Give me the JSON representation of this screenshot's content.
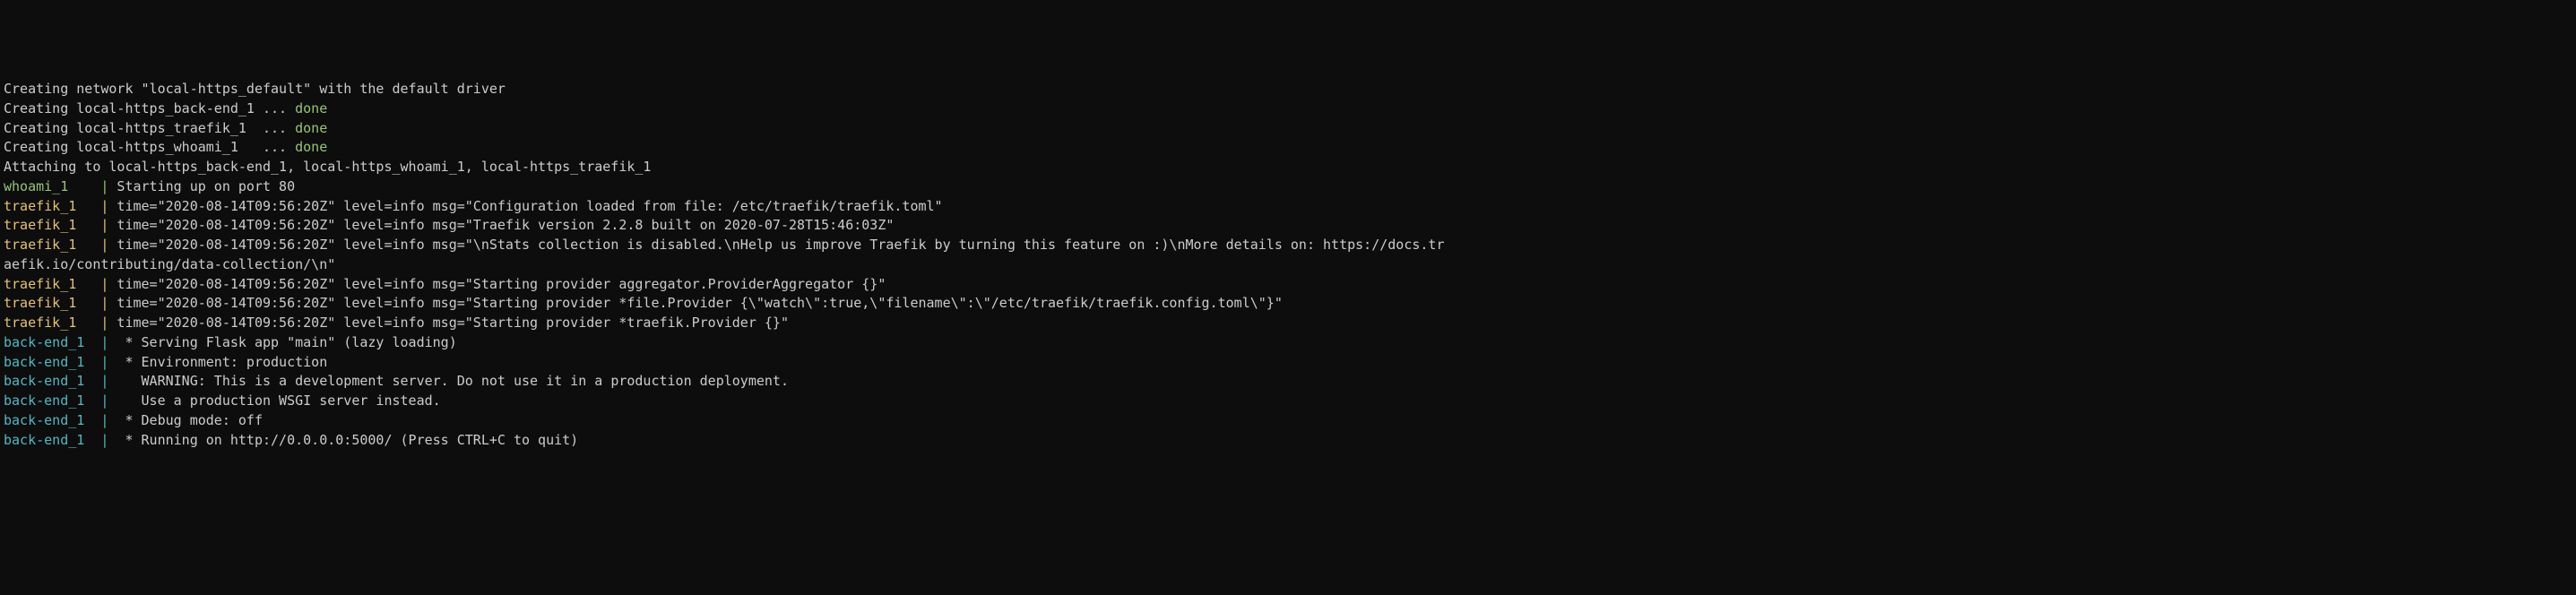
{
  "lines": [
    {
      "segments": [
        {
          "text": "Creating network \"local-https_default\" with the default driver",
          "class": "white"
        }
      ]
    },
    {
      "segments": [
        {
          "text": "Creating local-https_back-end_1 ... ",
          "class": "white"
        },
        {
          "text": "done",
          "class": "green"
        }
      ]
    },
    {
      "segments": [
        {
          "text": "Creating local-https_traefik_1  ... ",
          "class": "white"
        },
        {
          "text": "done",
          "class": "green"
        }
      ]
    },
    {
      "segments": [
        {
          "text": "Creating local-https_whoami_1   ... ",
          "class": "white"
        },
        {
          "text": "done",
          "class": "green"
        }
      ]
    },
    {
      "segments": [
        {
          "text": "Attaching to local-https_back-end_1, local-https_whoami_1, local-https_traefik_1",
          "class": "white"
        }
      ]
    },
    {
      "segments": [
        {
          "text": "whoami_1    ",
          "class": "green"
        },
        {
          "text": "|",
          "class": "green"
        },
        {
          "text": " Starting up on port 80",
          "class": "white"
        }
      ]
    },
    {
      "segments": [
        {
          "text": "traefik_1   ",
          "class": "yellow"
        },
        {
          "text": "|",
          "class": "yellow"
        },
        {
          "text": " time=\"2020-08-14T09:56:20Z\" level=info msg=\"Configuration loaded from file: /etc/traefik/traefik.toml\"",
          "class": "white"
        }
      ]
    },
    {
      "segments": [
        {
          "text": "traefik_1   ",
          "class": "yellow"
        },
        {
          "text": "|",
          "class": "yellow"
        },
        {
          "text": " time=\"2020-08-14T09:56:20Z\" level=info msg=\"Traefik version 2.2.8 built on 2020-07-28T15:46:03Z\"",
          "class": "white"
        }
      ]
    },
    {
      "segments": [
        {
          "text": "traefik_1   ",
          "class": "yellow"
        },
        {
          "text": "|",
          "class": "yellow"
        },
        {
          "text": " time=\"2020-08-14T09:56:20Z\" level=info msg=\"\\nStats collection is disabled.\\nHelp us improve Traefik by turning this feature on :)\\nMore details on: https://docs.tr",
          "class": "white"
        }
      ]
    },
    {
      "segments": [
        {
          "text": "aefik.io/contributing/data-collection/\\n\"",
          "class": "white"
        }
      ]
    },
    {
      "segments": [
        {
          "text": "traefik_1   ",
          "class": "yellow"
        },
        {
          "text": "|",
          "class": "yellow"
        },
        {
          "text": " time=\"2020-08-14T09:56:20Z\" level=info msg=\"Starting provider aggregator.ProviderAggregator {}\"",
          "class": "white"
        }
      ]
    },
    {
      "segments": [
        {
          "text": "traefik_1   ",
          "class": "yellow"
        },
        {
          "text": "|",
          "class": "yellow"
        },
        {
          "text": " time=\"2020-08-14T09:56:20Z\" level=info msg=\"Starting provider *file.Provider {\\\"watch\\\":true,\\\"filename\\\":\\\"/etc/traefik/traefik.config.toml\\\"}\"",
          "class": "white"
        }
      ]
    },
    {
      "segments": [
        {
          "text": "traefik_1   ",
          "class": "yellow"
        },
        {
          "text": "|",
          "class": "yellow"
        },
        {
          "text": " time=\"2020-08-14T09:56:20Z\" level=info msg=\"Starting provider *traefik.Provider {}\"",
          "class": "white"
        }
      ]
    },
    {
      "segments": [
        {
          "text": "back-end_1  ",
          "class": "cyan"
        },
        {
          "text": "|",
          "class": "cyan"
        },
        {
          "text": "  * Serving Flask app \"main\" (lazy loading)",
          "class": "white"
        }
      ]
    },
    {
      "segments": [
        {
          "text": "back-end_1  ",
          "class": "cyan"
        },
        {
          "text": "|",
          "class": "cyan"
        },
        {
          "text": "  * Environment: production",
          "class": "white"
        }
      ]
    },
    {
      "segments": [
        {
          "text": "back-end_1  ",
          "class": "cyan"
        },
        {
          "text": "|",
          "class": "cyan"
        },
        {
          "text": "    WARNING: This is a development server. Do not use it in a production deployment.",
          "class": "white"
        }
      ]
    },
    {
      "segments": [
        {
          "text": "back-end_1  ",
          "class": "cyan"
        },
        {
          "text": "|",
          "class": "cyan"
        },
        {
          "text": "    Use a production WSGI server instead.",
          "class": "white"
        }
      ]
    },
    {
      "segments": [
        {
          "text": "back-end_1  ",
          "class": "cyan"
        },
        {
          "text": "|",
          "class": "cyan"
        },
        {
          "text": "  * Debug mode: off",
          "class": "white"
        }
      ]
    },
    {
      "segments": [
        {
          "text": "back-end_1  ",
          "class": "cyan"
        },
        {
          "text": "|",
          "class": "cyan"
        },
        {
          "text": "  * Running on http://0.0.0.0:5000/ (Press CTRL+C to quit)",
          "class": "white"
        }
      ]
    }
  ]
}
